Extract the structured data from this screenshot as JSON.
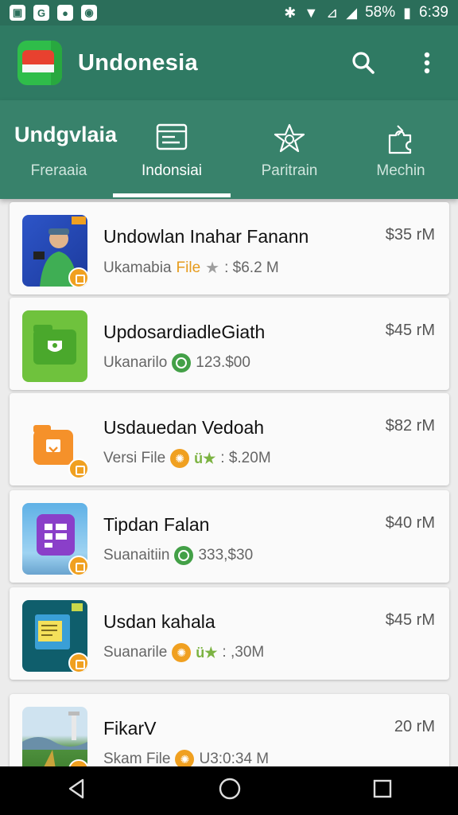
{
  "status_bar": {
    "battery": "58%",
    "time": "6:39"
  },
  "app_bar": {
    "title": "Undonesia"
  },
  "tabs": [
    {
      "label": "Freraaia",
      "icon": "text-heading",
      "heading": "Undgvlaia",
      "active": false
    },
    {
      "label": "Indonsiai",
      "icon": "list-document-icon",
      "active": true
    },
    {
      "label": "Paritrain",
      "icon": "star-badge-icon",
      "active": false
    },
    {
      "label": "Mechin",
      "icon": "puzzle-icon",
      "active": false
    }
  ],
  "items": [
    {
      "title": "Undowlan  Inahar Fanann",
      "price": "$35 rM",
      "meta_text": "Ukamabia",
      "meta_file": "File",
      "meta_value": ": $6.2 M",
      "meta_icon": "grey-star"
    },
    {
      "title": "UpdosardiadleGiath",
      "price": "$45 rM",
      "meta_text": "Ukanarilo",
      "meta_file": "",
      "meta_value": "123.$00",
      "meta_icon": "green-circle"
    },
    {
      "title": "Usdauedan Vedoah",
      "price": "$82 rM",
      "meta_text": "Versi File",
      "meta_file": "",
      "meta_value": ": $.20M",
      "meta_icon": "orange-circle-green-stars"
    },
    {
      "title": "Tipdan Falan",
      "price": "$40 rM",
      "meta_text": "Suanaitiin",
      "meta_file": "",
      "meta_value": "333,$30",
      "meta_icon": "green-circle"
    },
    {
      "title": "Usdan kahala",
      "price": "$45 rM",
      "meta_text": "Suanarile",
      "meta_file": "",
      "meta_value": ": ,30M",
      "meta_icon": "orange-circle-green-stars"
    },
    {
      "title": "FikarV",
      "price": "20 rM",
      "meta_text": "Skam File",
      "meta_file": "",
      "meta_value": "U3:0:34 M",
      "meta_icon": "orange-circle"
    }
  ],
  "colors": {
    "primary": "#2f7a63",
    "tab_bg": "#38826b",
    "accent_orange": "#f0a020",
    "accent_green": "#43a047"
  }
}
